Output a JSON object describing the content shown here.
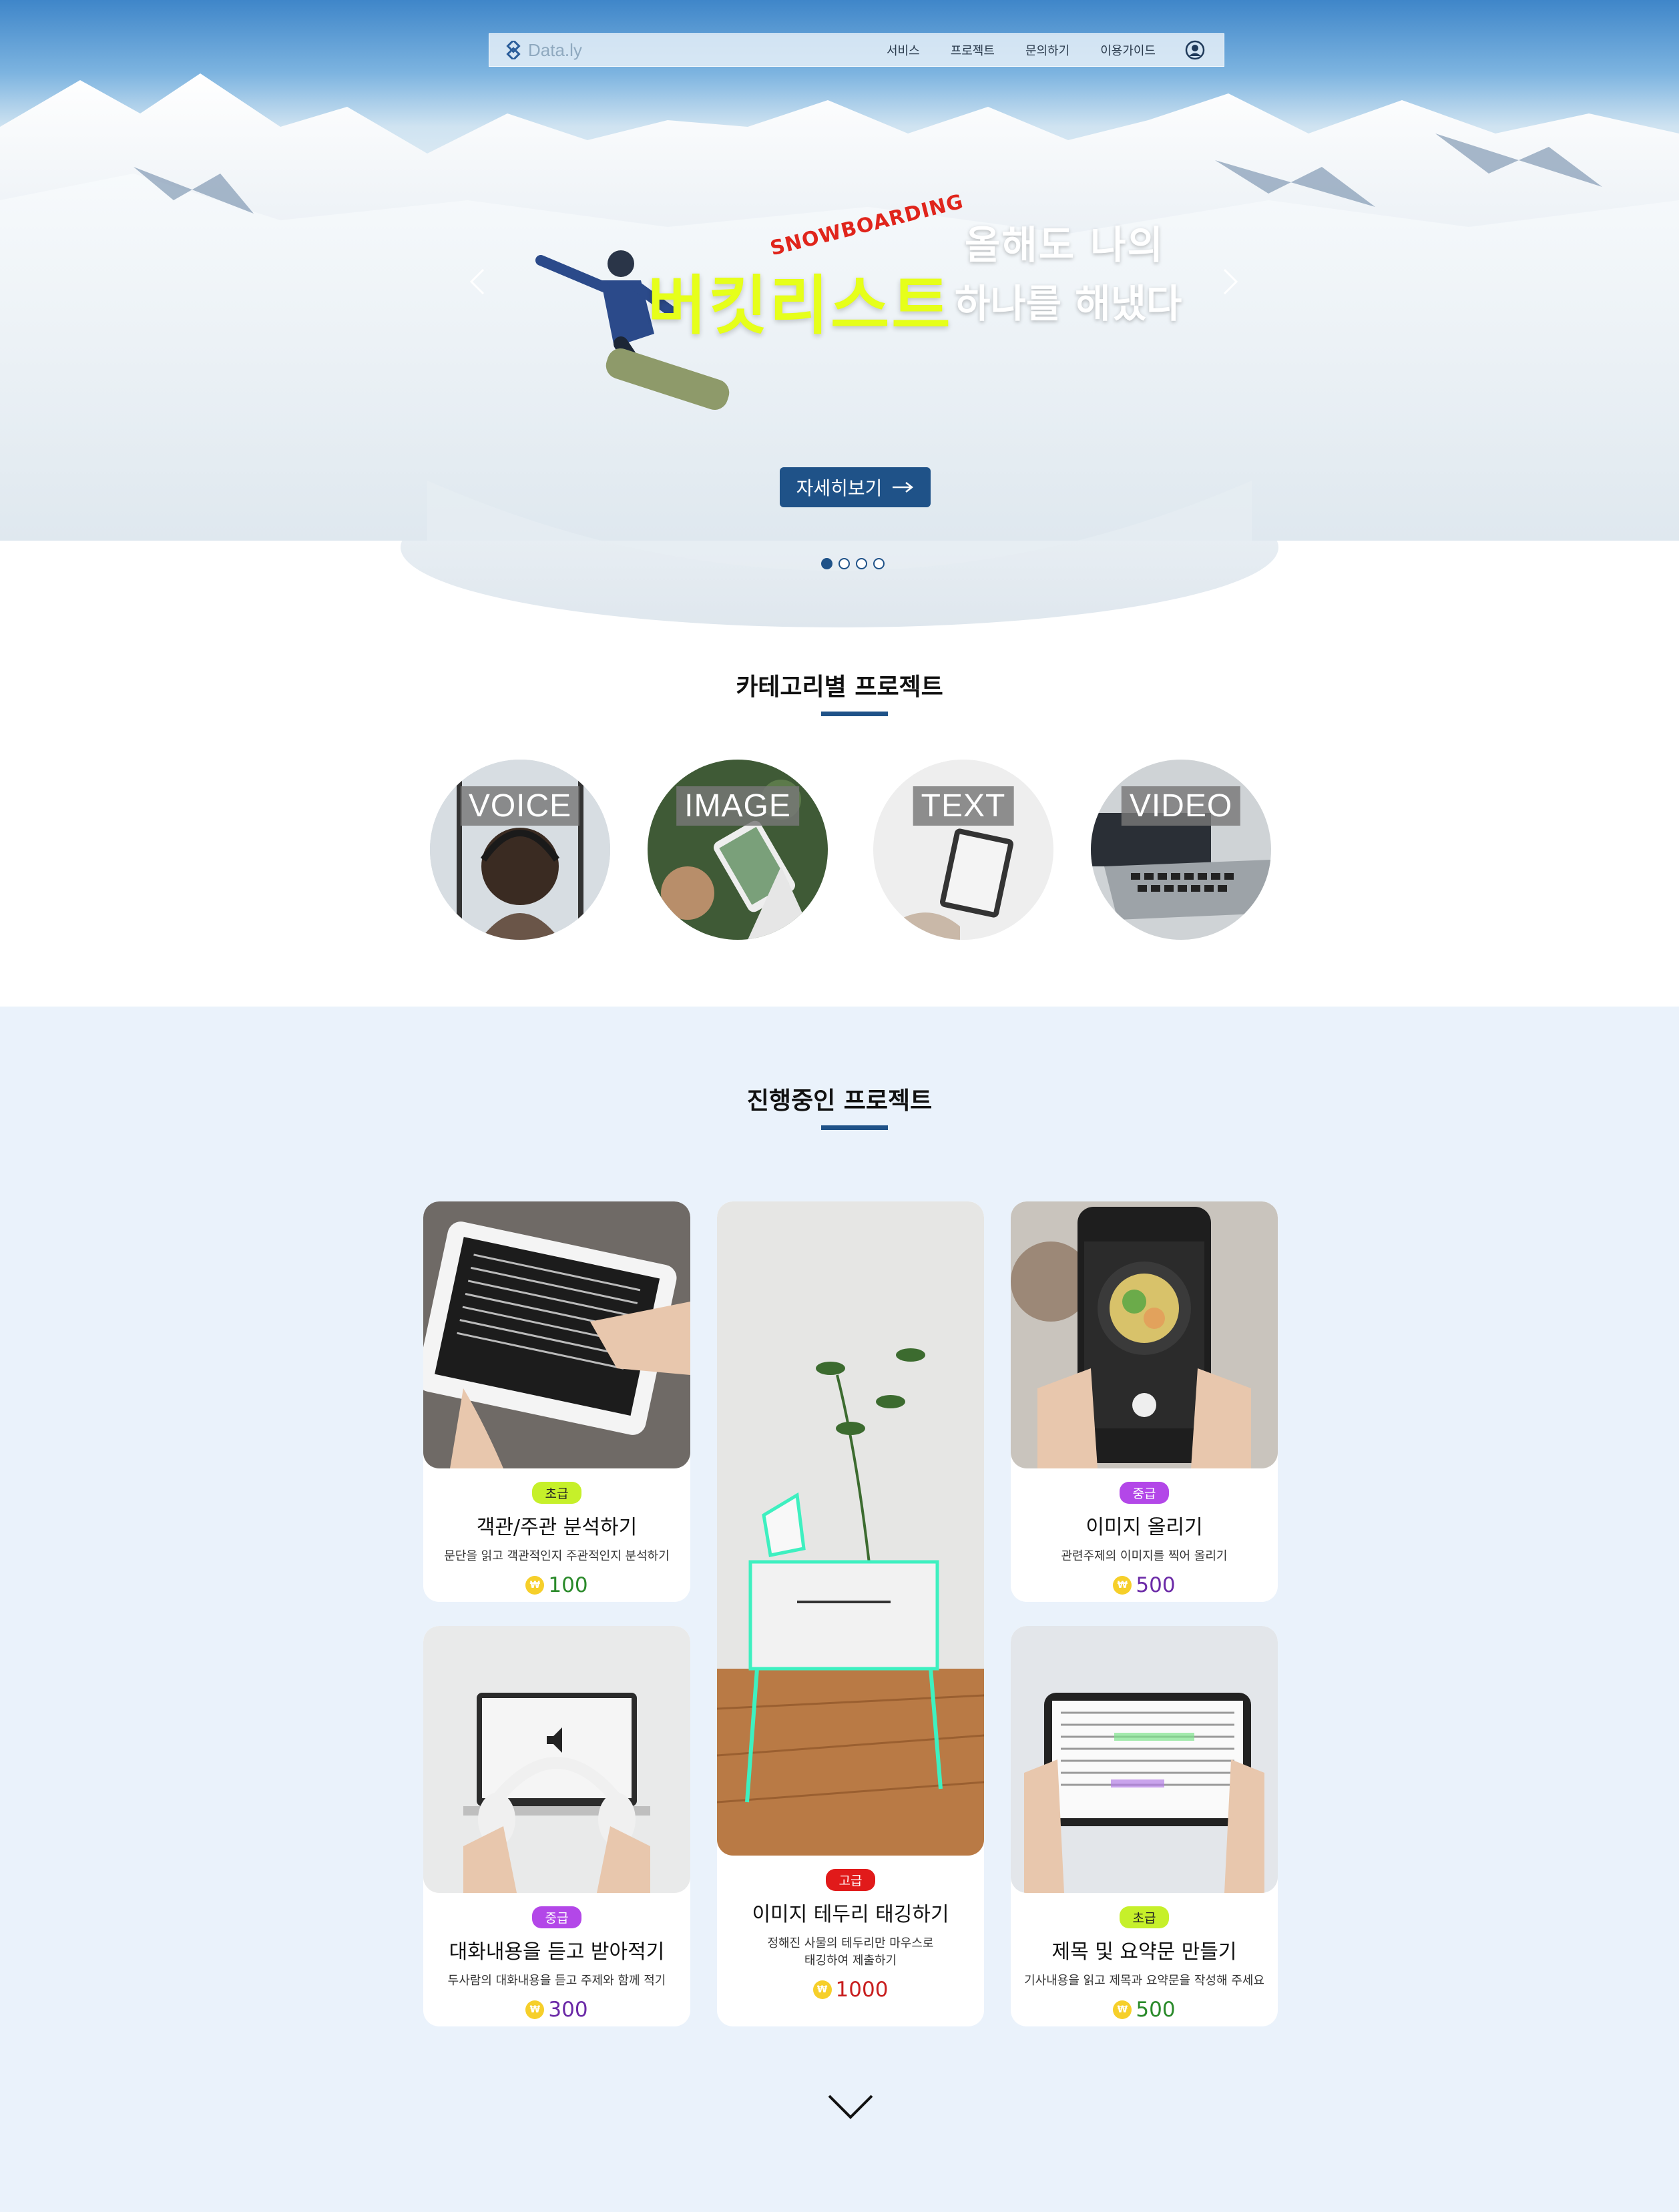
{
  "nav": {
    "logo": "Data.ly",
    "items": [
      "서비스",
      "프로젝트",
      "문의하기",
      "이용가이드"
    ]
  },
  "hero": {
    "tag": "SNOWBOARDING",
    "line1": "올해도 나의",
    "big": "버킷리스트",
    "line2": "하나를 해냈다",
    "button": "자세히보기",
    "slide_count": 4,
    "active_slide": 1
  },
  "category": {
    "title": "카테고리별 프로젝트",
    "items": [
      "VOICE",
      "IMAGE",
      "TEXT",
      "VIDEO"
    ]
  },
  "projects": {
    "title": "진행중인 프로젝트",
    "cards": [
      {
        "level": "초급",
        "title": "객관/주관 분석하기",
        "desc": "문단을 읽고 객관적인지 주관적인지 분석하기",
        "points": "100"
      },
      {
        "level": "중급",
        "title": "대화내용을 듣고 받아적기",
        "desc": "두사람의 대화내용을 듣고 주제와 함께 적기",
        "points": "300"
      },
      {
        "level": "고급",
        "title": "이미지 테두리 태깅하기",
        "desc1": "정해진 사물의 테두리만 마우스로",
        "desc2": "태깅하여 제출하기",
        "points": "1000"
      },
      {
        "level": "중급",
        "title": "이미지 올리기",
        "desc": "관련주제의 이미지를 찍어 올리기",
        "points": "500"
      },
      {
        "level": "초급",
        "title": "제목 및 요약문 만들기",
        "desc": "기사내용을 읽고 제목과 요약문을 작성해 주세요",
        "points": "500"
      }
    ],
    "coin_symbol": "₩"
  },
  "colors": {
    "accent": "#1f5288",
    "easy": "#c6f02a",
    "mid": "#b347e8",
    "hard": "#e11a1a",
    "section_bg": "#eaf2fb"
  }
}
